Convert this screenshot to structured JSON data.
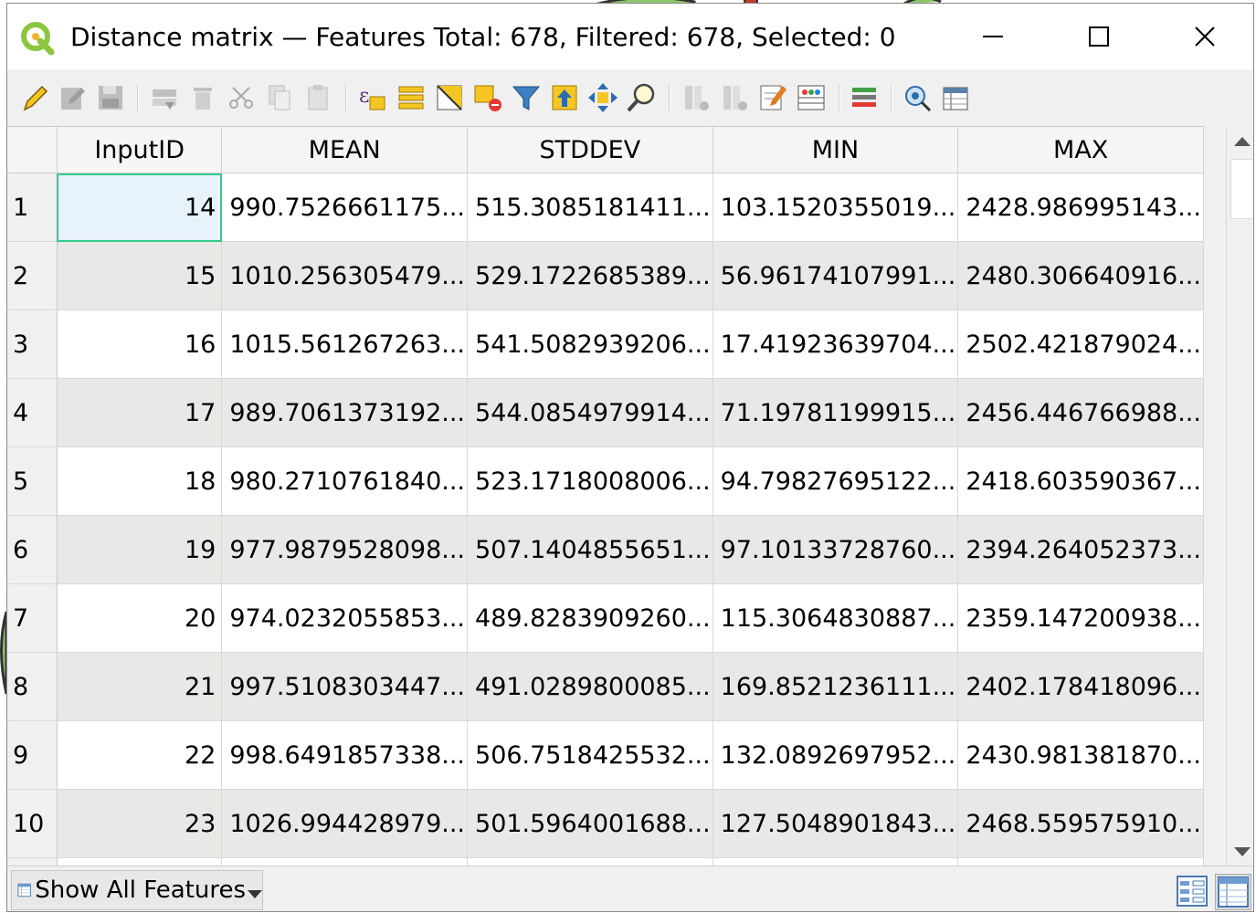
{
  "window": {
    "title": "Distance matrix — Features Total: 678, Filtered: 678, Selected: 0"
  },
  "colors": {
    "selected_outline": "#33cc88",
    "alt_row": "#e9e8e6",
    "selected_fill": "#e8f2fb"
  },
  "toolbar": {
    "icons": [
      "edit-pencil-icon",
      "multi-edit-icon",
      "save-edits-icon",
      "add-feature-icon",
      "delete-feature-icon",
      "cut-icon",
      "copy-icon",
      "paste-icon",
      "expression-select-icon",
      "select-all-icon",
      "invert-selection-icon",
      "deselect-icon",
      "filter-selected-icon",
      "move-selection-top-icon",
      "pan-to-selected-icon",
      "zoom-to-selected-icon",
      "new-field-icon",
      "delete-field-icon",
      "field-calculator-icon",
      "conditional-formatting-icon",
      "actions-icon",
      "dock-icon",
      "organize-columns-icon"
    ]
  },
  "table": {
    "headers": [
      "InputID",
      "MEAN",
      "STDDEV",
      "MIN",
      "MAX"
    ],
    "rows": [
      {
        "n": "1",
        "id": "14",
        "mean": "990.7526661175...",
        "std": "515.3085181411...",
        "min": "103.1520355019...",
        "max": "2428.986995143..."
      },
      {
        "n": "2",
        "id": "15",
        "mean": "1010.256305479...",
        "std": "529.1722685389...",
        "min": "56.96174107991...",
        "max": "2480.306640916..."
      },
      {
        "n": "3",
        "id": "16",
        "mean": "1015.561267263...",
        "std": "541.5082939206...",
        "min": "17.41923639704...",
        "max": "2502.421879024..."
      },
      {
        "n": "4",
        "id": "17",
        "mean": "989.7061373192...",
        "std": "544.0854979914...",
        "min": "71.19781199915...",
        "max": "2456.446766988..."
      },
      {
        "n": "5",
        "id": "18",
        "mean": "980.2710761840...",
        "std": "523.1718008006...",
        "min": "94.79827695122...",
        "max": "2418.603590367..."
      },
      {
        "n": "6",
        "id": "19",
        "mean": "977.9879528098...",
        "std": "507.1404855651...",
        "min": "97.10133728760...",
        "max": "2394.264052373..."
      },
      {
        "n": "7",
        "id": "20",
        "mean": "974.0232055853...",
        "std": "489.8283909260...",
        "min": "115.3064830887...",
        "max": "2359.147200938..."
      },
      {
        "n": "8",
        "id": "21",
        "mean": "997.5108303447...",
        "std": "491.0289800085...",
        "min": "169.8521236111...",
        "max": "2402.178418096..."
      },
      {
        "n": "9",
        "id": "22",
        "mean": "998.6491857338...",
        "std": "506.7518425532...",
        "min": "132.0892697952...",
        "max": "2430.981381870..."
      },
      {
        "n": "10",
        "id": "23",
        "mean": "1026.994428979...",
        "std": "501.5964001688...",
        "min": "127.5048901843...",
        "max": "2468.559575910..."
      }
    ]
  },
  "bottom": {
    "filter_label": "Show All Features"
  }
}
